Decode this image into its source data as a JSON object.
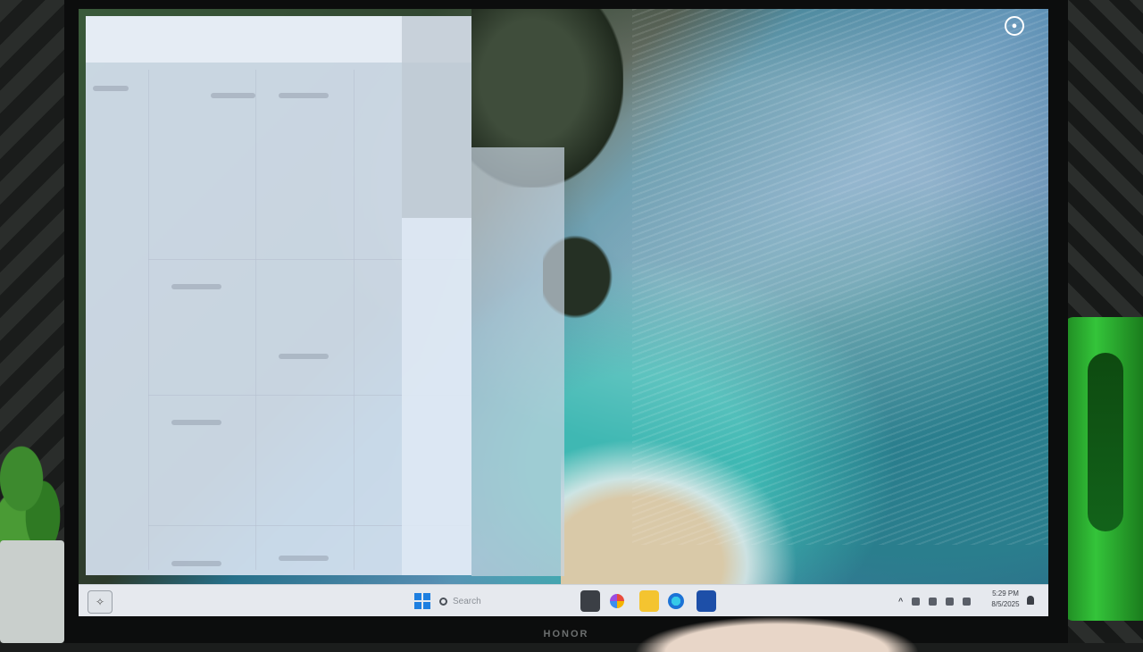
{
  "device": {
    "brand": "HONOR"
  },
  "desktop": {
    "wallpaper": "aerial ocean cliff coastline",
    "corner_icon": "account-circle-icon"
  },
  "launching_window": {
    "state": "opening / translucent placeholder"
  },
  "taskbar": {
    "widgets_icon": "widgets-icon",
    "start_icon": "windows-start-icon",
    "search": {
      "icon": "search-icon",
      "placeholder": "Search"
    },
    "pinned_apps": [
      {
        "name": "task-view",
        "icon": "task-view-icon"
      },
      {
        "name": "copilot",
        "icon": "copilot-icon"
      },
      {
        "name": "file-explorer",
        "icon": "folder-icon"
      },
      {
        "name": "edge",
        "icon": "edge-icon"
      },
      {
        "name": "store",
        "icon": "store-icon"
      }
    ],
    "tray": {
      "chevron": "^",
      "time": "5:29 PM",
      "date": "8/5/2025"
    }
  },
  "colors": {
    "taskbar_bg": "#e6e9ee",
    "start_blue": "#1e7fe0",
    "bezel": "#0c0d0d"
  }
}
